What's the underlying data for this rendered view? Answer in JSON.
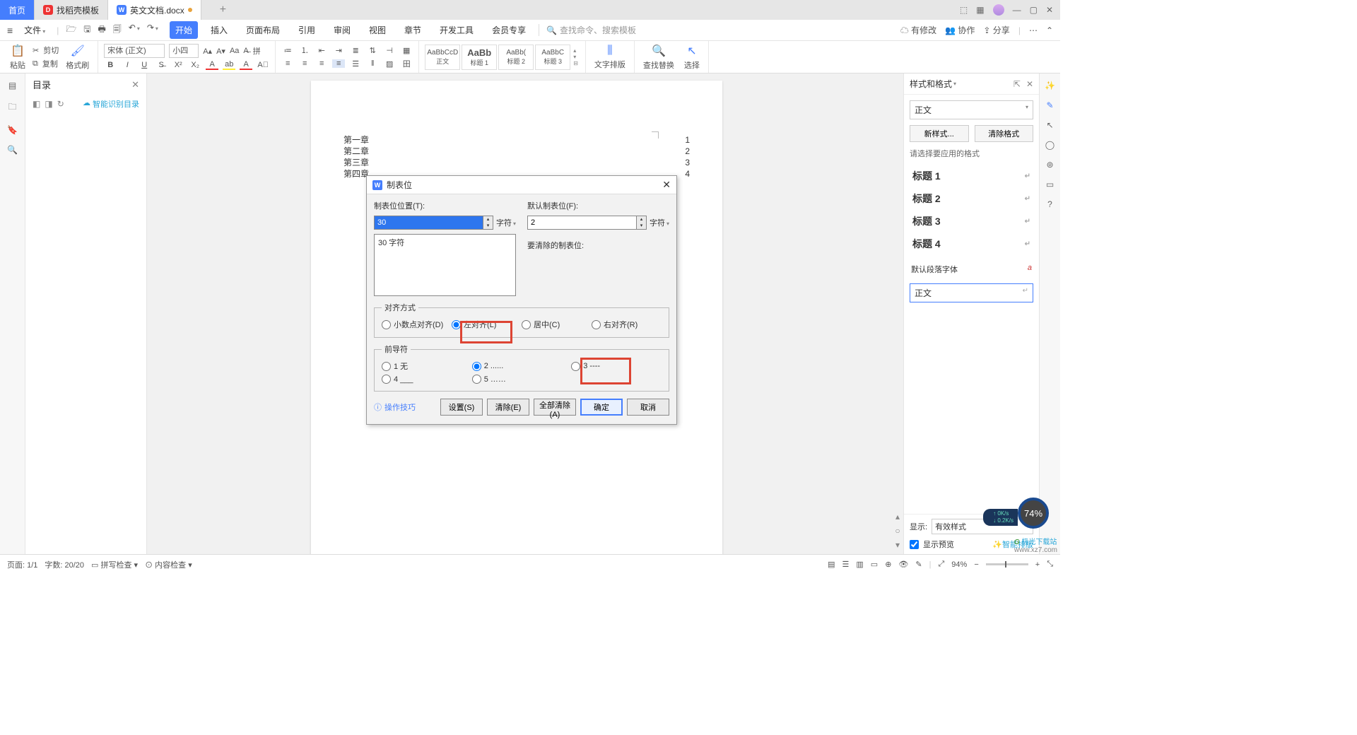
{
  "tabs": {
    "home": "首页",
    "t1": "找稻壳模板",
    "t2": "英文文档.docx"
  },
  "menurow": {
    "file": "文件",
    "tabs": [
      "开始",
      "插入",
      "页面布局",
      "引用",
      "审阅",
      "视图",
      "章节",
      "开发工具",
      "会员专享"
    ],
    "search_ph": "查找命令、搜索模板",
    "right": {
      "changes": "有修改",
      "coop": "协作",
      "share": "分享"
    }
  },
  "ribbon": {
    "paste": "粘贴",
    "cut": "剪切",
    "copy": "复制",
    "fmt": "格式刷",
    "font": "宋体 (正文)",
    "size": "小四",
    "style_prev": "AaBbCcD",
    "style_prev2": "AaBbC",
    "style_labels": [
      "正文",
      "标题 1",
      "标题 2",
      "标题 3"
    ],
    "layout": "文字排版",
    "find": "查找替换",
    "select": "选择"
  },
  "toc": {
    "title": "目录",
    "ai": "智能识别目录"
  },
  "doc": {
    "lines": [
      {
        "t": "第一章",
        "n": "1"
      },
      {
        "t": "第二章",
        "n": "2"
      },
      {
        "t": "第三章",
        "n": "3"
      },
      {
        "t": "第四章",
        "n": "4"
      }
    ]
  },
  "rpanel": {
    "title": "样式和格式",
    "current": "正文",
    "btn_new": "新样式...",
    "btn_clear": "清除格式",
    "hint": "请选择要应用的格式",
    "items": [
      "标题 1",
      "标题 2",
      "标题 3",
      "标题 4"
    ],
    "deffont": "默认段落字体",
    "editval": "正文",
    "show_lbl": "显示:",
    "show_val": "有效样式",
    "preview": "显示预览",
    "ai": "智能排版"
  },
  "dialog": {
    "title": "制表位",
    "pos_lbl": "制表位位置(T):",
    "pos_val": "30",
    "unit": "字符",
    "def_lbl": "默认制表位(F):",
    "def_val": "2",
    "clear_lbl": "要清除的制表位:",
    "listitem": "30 字符",
    "align_legend": "对齐方式",
    "align": {
      "dec": "小数点对齐(D)",
      "left": "左对齐(L)",
      "center": "居中(C)",
      "right": "右对齐(R)"
    },
    "leader_legend": "前导符",
    "leader": {
      "l1": "1 无",
      "l2": "2 ......",
      "l3": "3 ----",
      "l4": "4 ___",
      "l5": "5 ……"
    },
    "tip": "操作技巧",
    "btns": {
      "set": "设置(S)",
      "clear": "清除(E)",
      "clearall": "全部清除(A)",
      "ok": "确定",
      "cancel": "取消"
    }
  },
  "status": {
    "page": "页面: 1/1",
    "words": "字数: 20/20",
    "spell": "拼写检查",
    "content": "内容检查",
    "zoom": "94%"
  },
  "badge": "74%",
  "speed": {
    "up": "0K/s",
    "down": "0.2K/s"
  },
  "watermark": {
    "a": "极光下载站",
    "b": "www.xz7.com"
  }
}
